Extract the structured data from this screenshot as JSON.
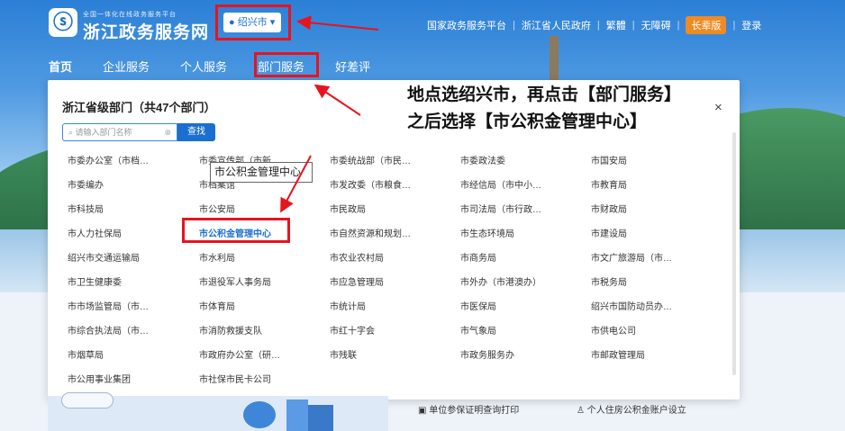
{
  "header": {
    "logo_glyph": "ⓢ",
    "logo_subtitle": "全国一体化在线政务服务平台",
    "logo_title": "浙江政务服务网",
    "city_select": "绍兴市 ▾",
    "top_links": [
      "国家政务服务平台",
      "浙江省人民政府",
      "繁體",
      "无障碍"
    ],
    "elder_button": "长辈版",
    "login": "登录"
  },
  "nav": [
    "首页",
    "企业服务",
    "个人服务",
    "部门服务",
    "好差评"
  ],
  "panel": {
    "title": "浙江省级部门（共47个部门）",
    "search_placeholder": "请输入部门名称",
    "search_button": "查找",
    "close": "×",
    "departments": [
      [
        "市委办公室（市档…",
        "市委宣传部（市新…",
        "市委统战部（市民…",
        "市委政法委",
        "市国安局"
      ],
      [
        "市委编办",
        "市档案馆",
        "市发改委（市粮食…",
        "市经信局（市中小…",
        "市教育局"
      ],
      [
        "市科技局",
        "市公安局",
        "市民政局",
        "市司法局（市行政…",
        "市财政局"
      ],
      [
        "市人力社保局",
        "市公积金管理中心",
        "市自然资源和规划…",
        "市生态环境局",
        "市建设局"
      ],
      [
        "绍兴市交通运输局",
        "市水利局",
        "市农业农村局",
        "市商务局",
        "市文广旅游局（市…"
      ],
      [
        "市卫生健康委",
        "市退役军人事务局",
        "市应急管理局",
        "市外办（市港澳办）",
        "市税务局"
      ],
      [
        "市市场监管局（市…",
        "市体育局",
        "市统计局",
        "市医保局",
        "绍兴市国防动员办…"
      ],
      [
        "市综合执法局（市…",
        "市消防救援支队",
        "市红十字会",
        "市气象局",
        "市供电公司"
      ],
      [
        "市烟草局",
        "市政府办公室（研…",
        "市残联",
        "市政务服务办",
        "市邮政管理局"
      ],
      [
        "市公用事业集团",
        "市社保市民卡公司",
        "",
        "",
        ""
      ]
    ],
    "tooltip": "市公积金管理中心"
  },
  "annotation": {
    "line1": "地点选绍兴市，再点击【部门服务】",
    "line2": "之后选择【市公积金管理中心】"
  },
  "bottom": {
    "service1": "单位参保证明查询打印",
    "service2": "个人住房公积金账户设立"
  },
  "colors": {
    "brand_blue": "#1a6fd0",
    "highlight_red": "#e6141e",
    "elder_orange": "#f08a24"
  }
}
